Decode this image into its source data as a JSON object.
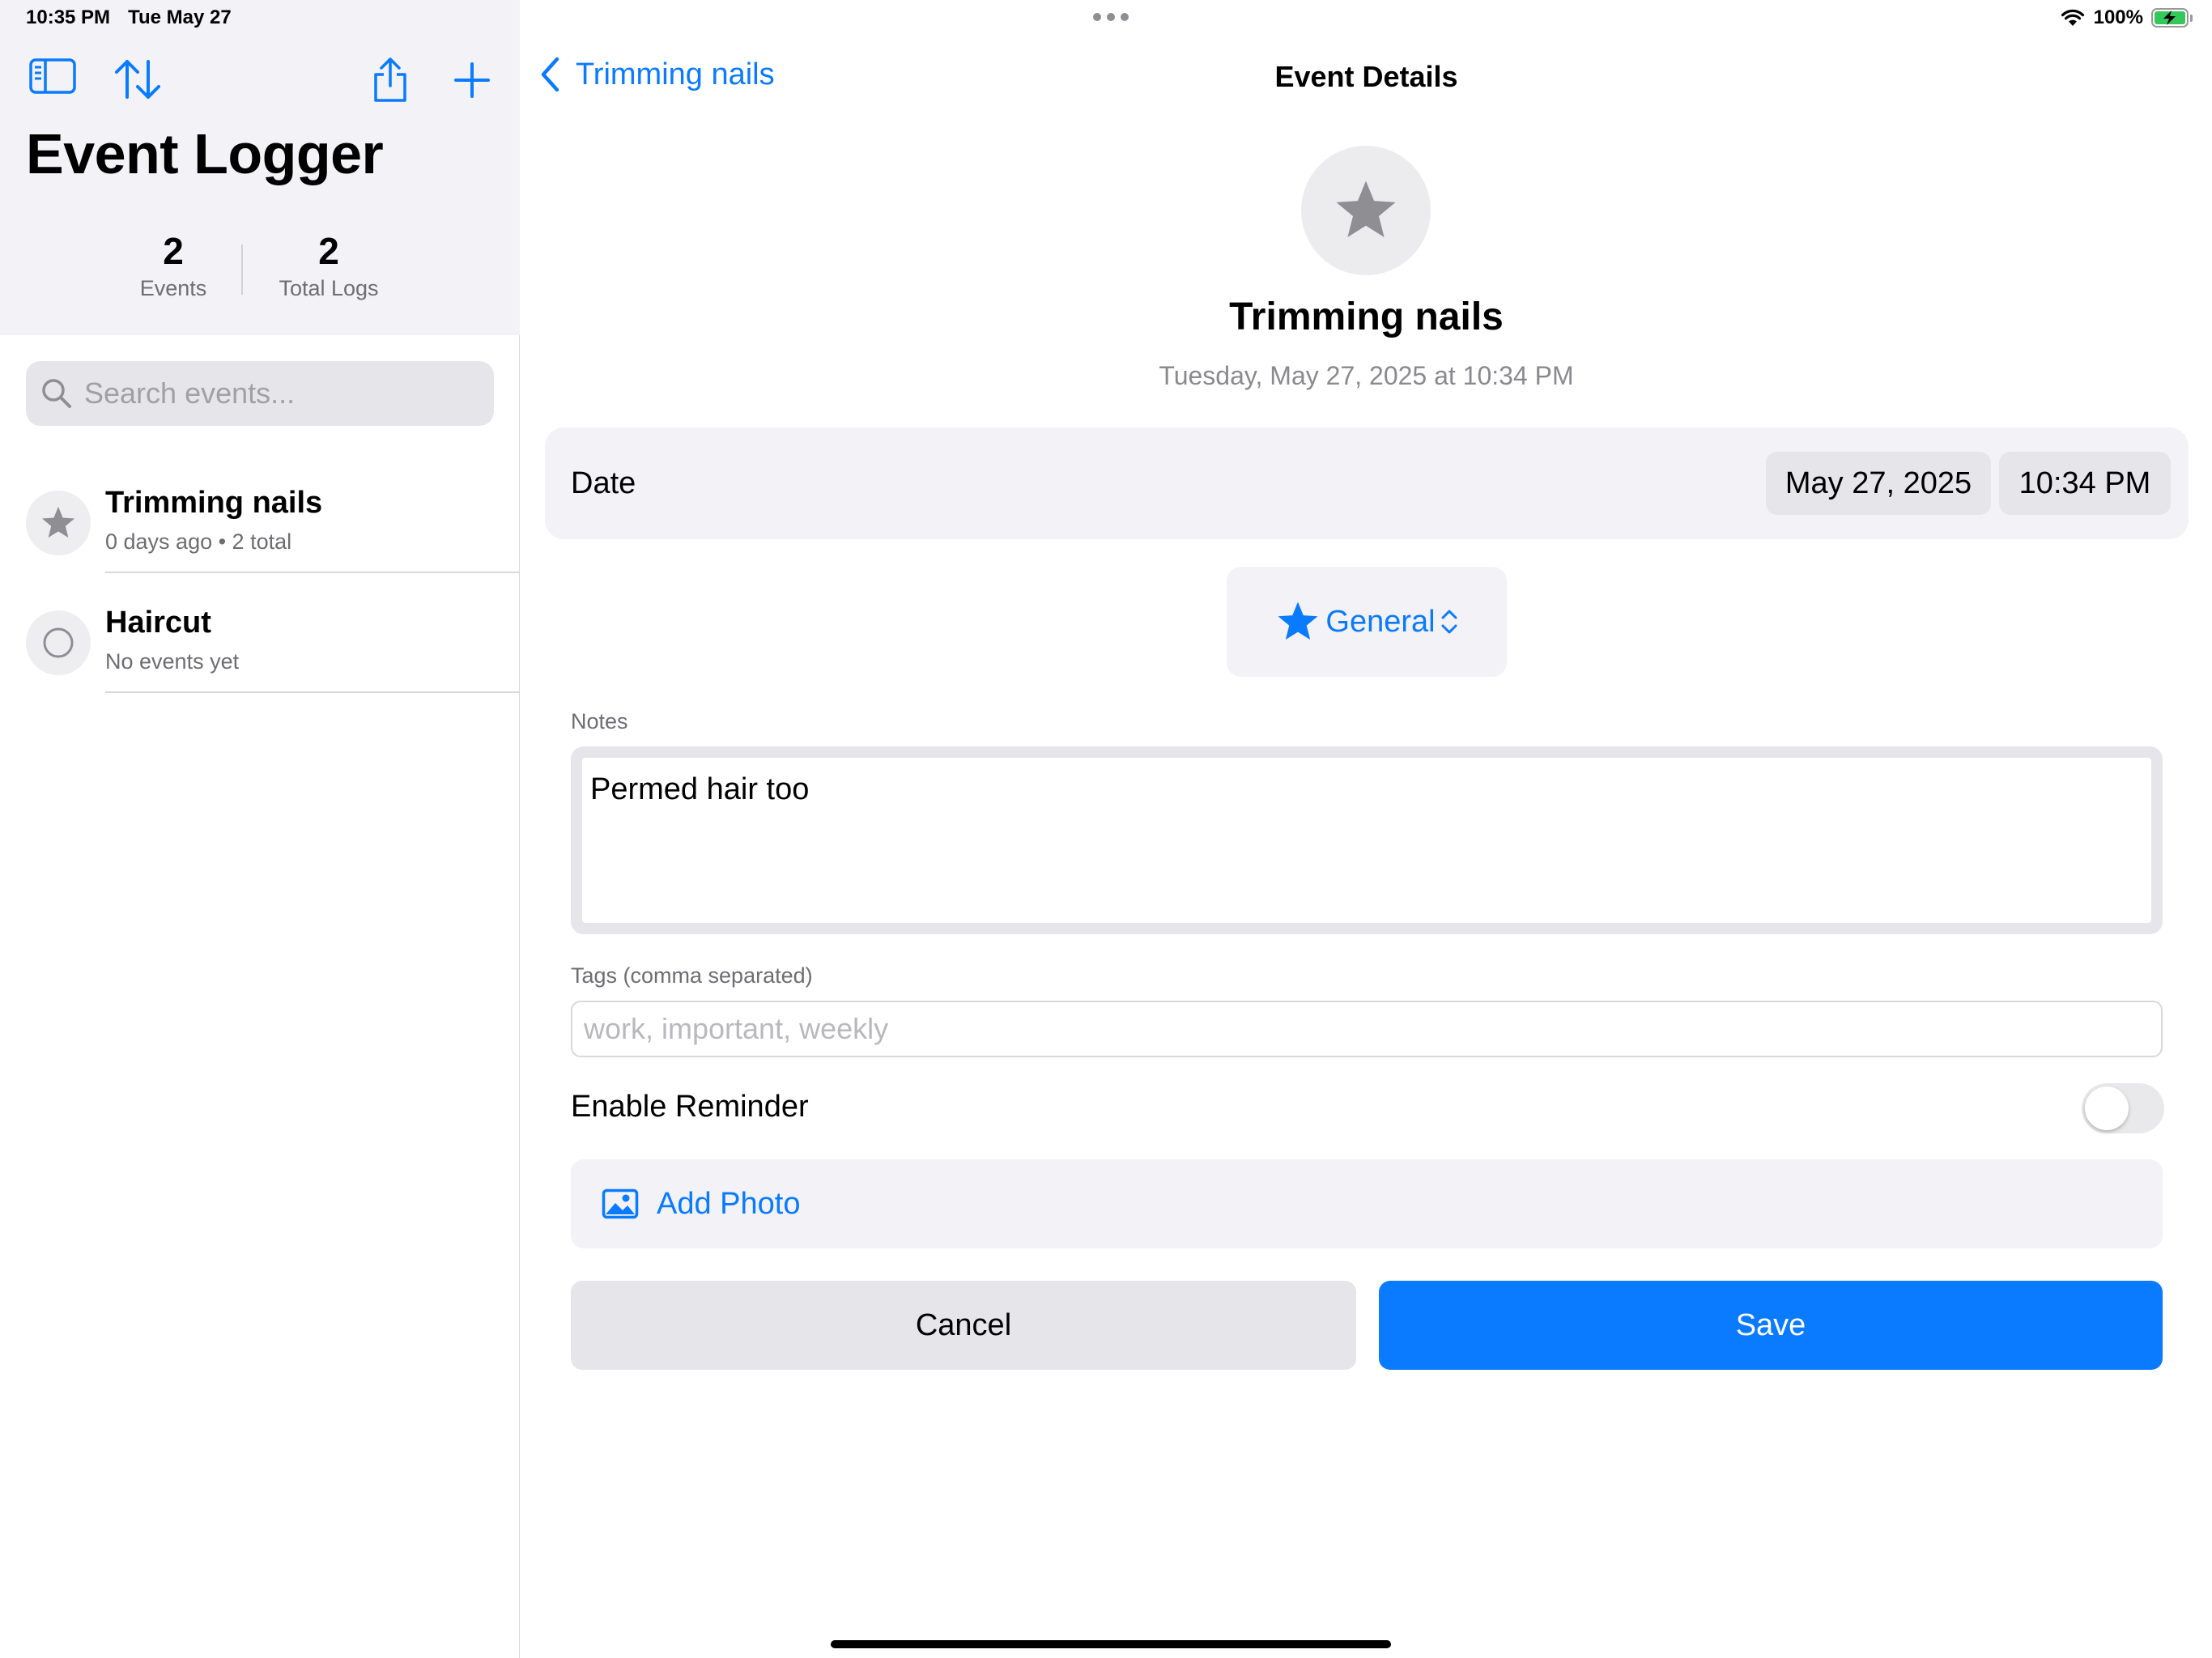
{
  "status_bar": {
    "time": "10:35 PM",
    "date": "Tue May 27",
    "battery": "100%"
  },
  "sidebar": {
    "title": "Event Logger",
    "stats": [
      {
        "value": "2",
        "label": "Events"
      },
      {
        "value": "2",
        "label": "Total Logs"
      }
    ],
    "search": {
      "placeholder": "Search events..."
    },
    "events": [
      {
        "name": "Trimming nails",
        "subtitle": "0 days ago • 2 total",
        "icon": "star-icon",
        "selected": true
      },
      {
        "name": "Haircut",
        "subtitle": "No events yet",
        "icon": "circle-icon",
        "selected": false
      }
    ]
  },
  "detail": {
    "back_label": "Trimming nails",
    "nav_title": "Event Details",
    "event_name": "Trimming nails",
    "event_datetime": "Tuesday, May 27, 2025 at 10:34 PM",
    "date_row": {
      "label": "Date",
      "date_value": "May 27, 2025",
      "time_value": "10:34 PM"
    },
    "category": {
      "label": "General",
      "icon": "star-icon"
    },
    "notes": {
      "label": "Notes",
      "value": "Permed hair too"
    },
    "tags": {
      "label": "Tags (comma separated)",
      "value": "",
      "placeholder": "work, important, weekly"
    },
    "reminder": {
      "label": "Enable Reminder",
      "enabled": false
    },
    "add_photo_label": "Add Photo",
    "cancel_label": "Cancel",
    "save_label": "Save"
  },
  "colors": {
    "accent": "#0a7aff",
    "grouped_background": "#f2f2f7",
    "secondary_text": "#6d6d72",
    "battery_green": "#34c759"
  }
}
